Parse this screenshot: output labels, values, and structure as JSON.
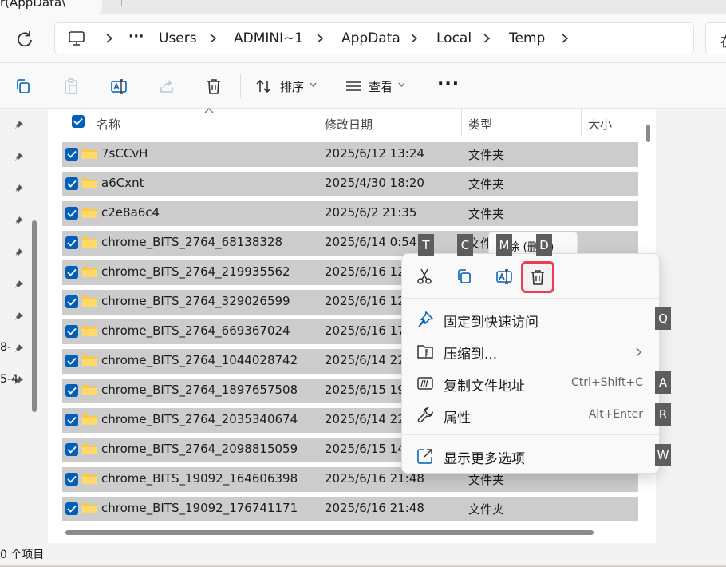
{
  "window": {
    "tab_title": "r(AppData\\"
  },
  "address": {
    "segments": [
      "Users",
      "ADMINI~1",
      "AppData",
      "Local",
      "Temp"
    ],
    "ellipsis": "···",
    "search_fragment": "在"
  },
  "toolbar": {
    "sort_label": "排序",
    "view_label": "查看",
    "more_label": "···"
  },
  "nav": {
    "fragments": [
      "8-",
      "5-4"
    ]
  },
  "columns": {
    "name": "名称",
    "modified": "修改日期",
    "type": "类型",
    "size": "大小"
  },
  "files": [
    {
      "name": "7sCCvH",
      "date": "2025/6/12 13:24",
      "type": "文件夹"
    },
    {
      "name": "a6Cxnt",
      "date": "2025/4/30 18:20",
      "type": "文件夹"
    },
    {
      "name": "c2e8a6c4",
      "date": "2025/6/2 21:35",
      "type": "文件夹"
    },
    {
      "name": "chrome_BITS_2764_68138328",
      "date": "2025/6/14 0:54",
      "type": "文件夹"
    },
    {
      "name": "chrome_BITS_2764_219935562",
      "date": "2025/6/16 12",
      "type": ""
    },
    {
      "name": "chrome_BITS_2764_329026599",
      "date": "2025/6/16 12",
      "type": ""
    },
    {
      "name": "chrome_BITS_2764_669367024",
      "date": "2025/6/16 17",
      "type": ""
    },
    {
      "name": "chrome_BITS_2764_1044028742",
      "date": "2025/6/14 22",
      "type": ""
    },
    {
      "name": "chrome_BITS_2764_1897657508",
      "date": "2025/6/15 19",
      "type": ""
    },
    {
      "name": "chrome_BITS_2764_2035340674",
      "date": "2025/6/14 22",
      "type": ""
    },
    {
      "name": "chrome_BITS_2764_2098815059",
      "date": "2025/6/15 14",
      "type": ""
    },
    {
      "name": "chrome_BITS_19092_164606398",
      "date": "2025/6/16 21:48",
      "type": "文件夹"
    },
    {
      "name": "chrome_BITS_19092_176741171",
      "date": "2025/6/16 21:48",
      "type": "文件夹"
    }
  ],
  "status": {
    "text": "0 个项目"
  },
  "tooltip": {
    "text": "删除 (删除)"
  },
  "context_menu": {
    "access_keys": {
      "cut": "T",
      "copy": "C",
      "rename": "M",
      "delete": "D"
    },
    "items": [
      {
        "label": "固定到快速访问",
        "shortcut": "",
        "key": "Q"
      },
      {
        "label": "压缩到...",
        "shortcut": "",
        "key": ""
      },
      {
        "label": "复制文件地址",
        "shortcut": "Ctrl+Shift+C",
        "key": "A"
      },
      {
        "label": "属性",
        "shortcut": "Alt+Enter",
        "key": "R"
      },
      {
        "label": "显示更多选项",
        "shortcut": "",
        "key": "W"
      }
    ]
  },
  "colors": {
    "accent": "#005fb8",
    "selection": "#cccccc",
    "delete_highlight": "#ee3b55",
    "folder": "#ffc83d"
  }
}
